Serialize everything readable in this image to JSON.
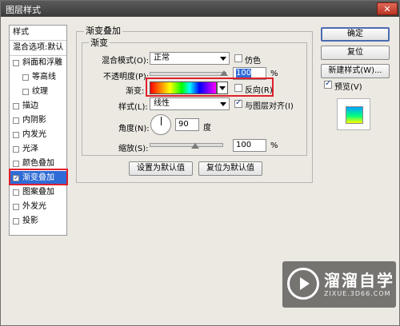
{
  "window": {
    "title": "图层样式",
    "close_label": "✕"
  },
  "left_panel": {
    "header": "样式",
    "blend_options": "混合选项:默认",
    "items": [
      {
        "label": "斜面和浮雕",
        "checked": false
      },
      {
        "label": "等高线",
        "checked": false
      },
      {
        "label": "纹理",
        "checked": false
      },
      {
        "label": "描边",
        "checked": false
      },
      {
        "label": "内阴影",
        "checked": false
      },
      {
        "label": "内发光",
        "checked": false
      },
      {
        "label": "光泽",
        "checked": false
      },
      {
        "label": "颜色叠加",
        "checked": false
      },
      {
        "label": "渐变叠加",
        "checked": true
      },
      {
        "label": "图案叠加",
        "checked": false
      },
      {
        "label": "外发光",
        "checked": false
      },
      {
        "label": "投影",
        "checked": false
      }
    ]
  },
  "section": {
    "title": "渐变叠加",
    "subtitle": "渐变",
    "blend_mode_label": "混合模式(O):",
    "blend_mode_value": "正常",
    "dither_label": "仿色",
    "opacity_label": "不透明度(P):",
    "opacity_value": "100",
    "opacity_unit": "%",
    "gradient_label": "渐变:",
    "reverse_label": "反向(R)",
    "style_label": "样式(L):",
    "style_value": "线性",
    "align_label": "与图层对齐(I)",
    "angle_label": "角度(N):",
    "angle_value": "90",
    "angle_unit": "度",
    "scale_label": "缩放(S):",
    "scale_value": "100",
    "scale_unit": "%",
    "set_default_btn": "设置为默认值",
    "reset_default_btn": "复位为默认值"
  },
  "right_panel": {
    "ok": "确定",
    "reset": "复位",
    "new_style": "新建样式(W)...",
    "preview_label": "预览(V)"
  },
  "watermark": {
    "title": "溜溜自学",
    "sub": "ZIXUE.3D66.COM"
  }
}
